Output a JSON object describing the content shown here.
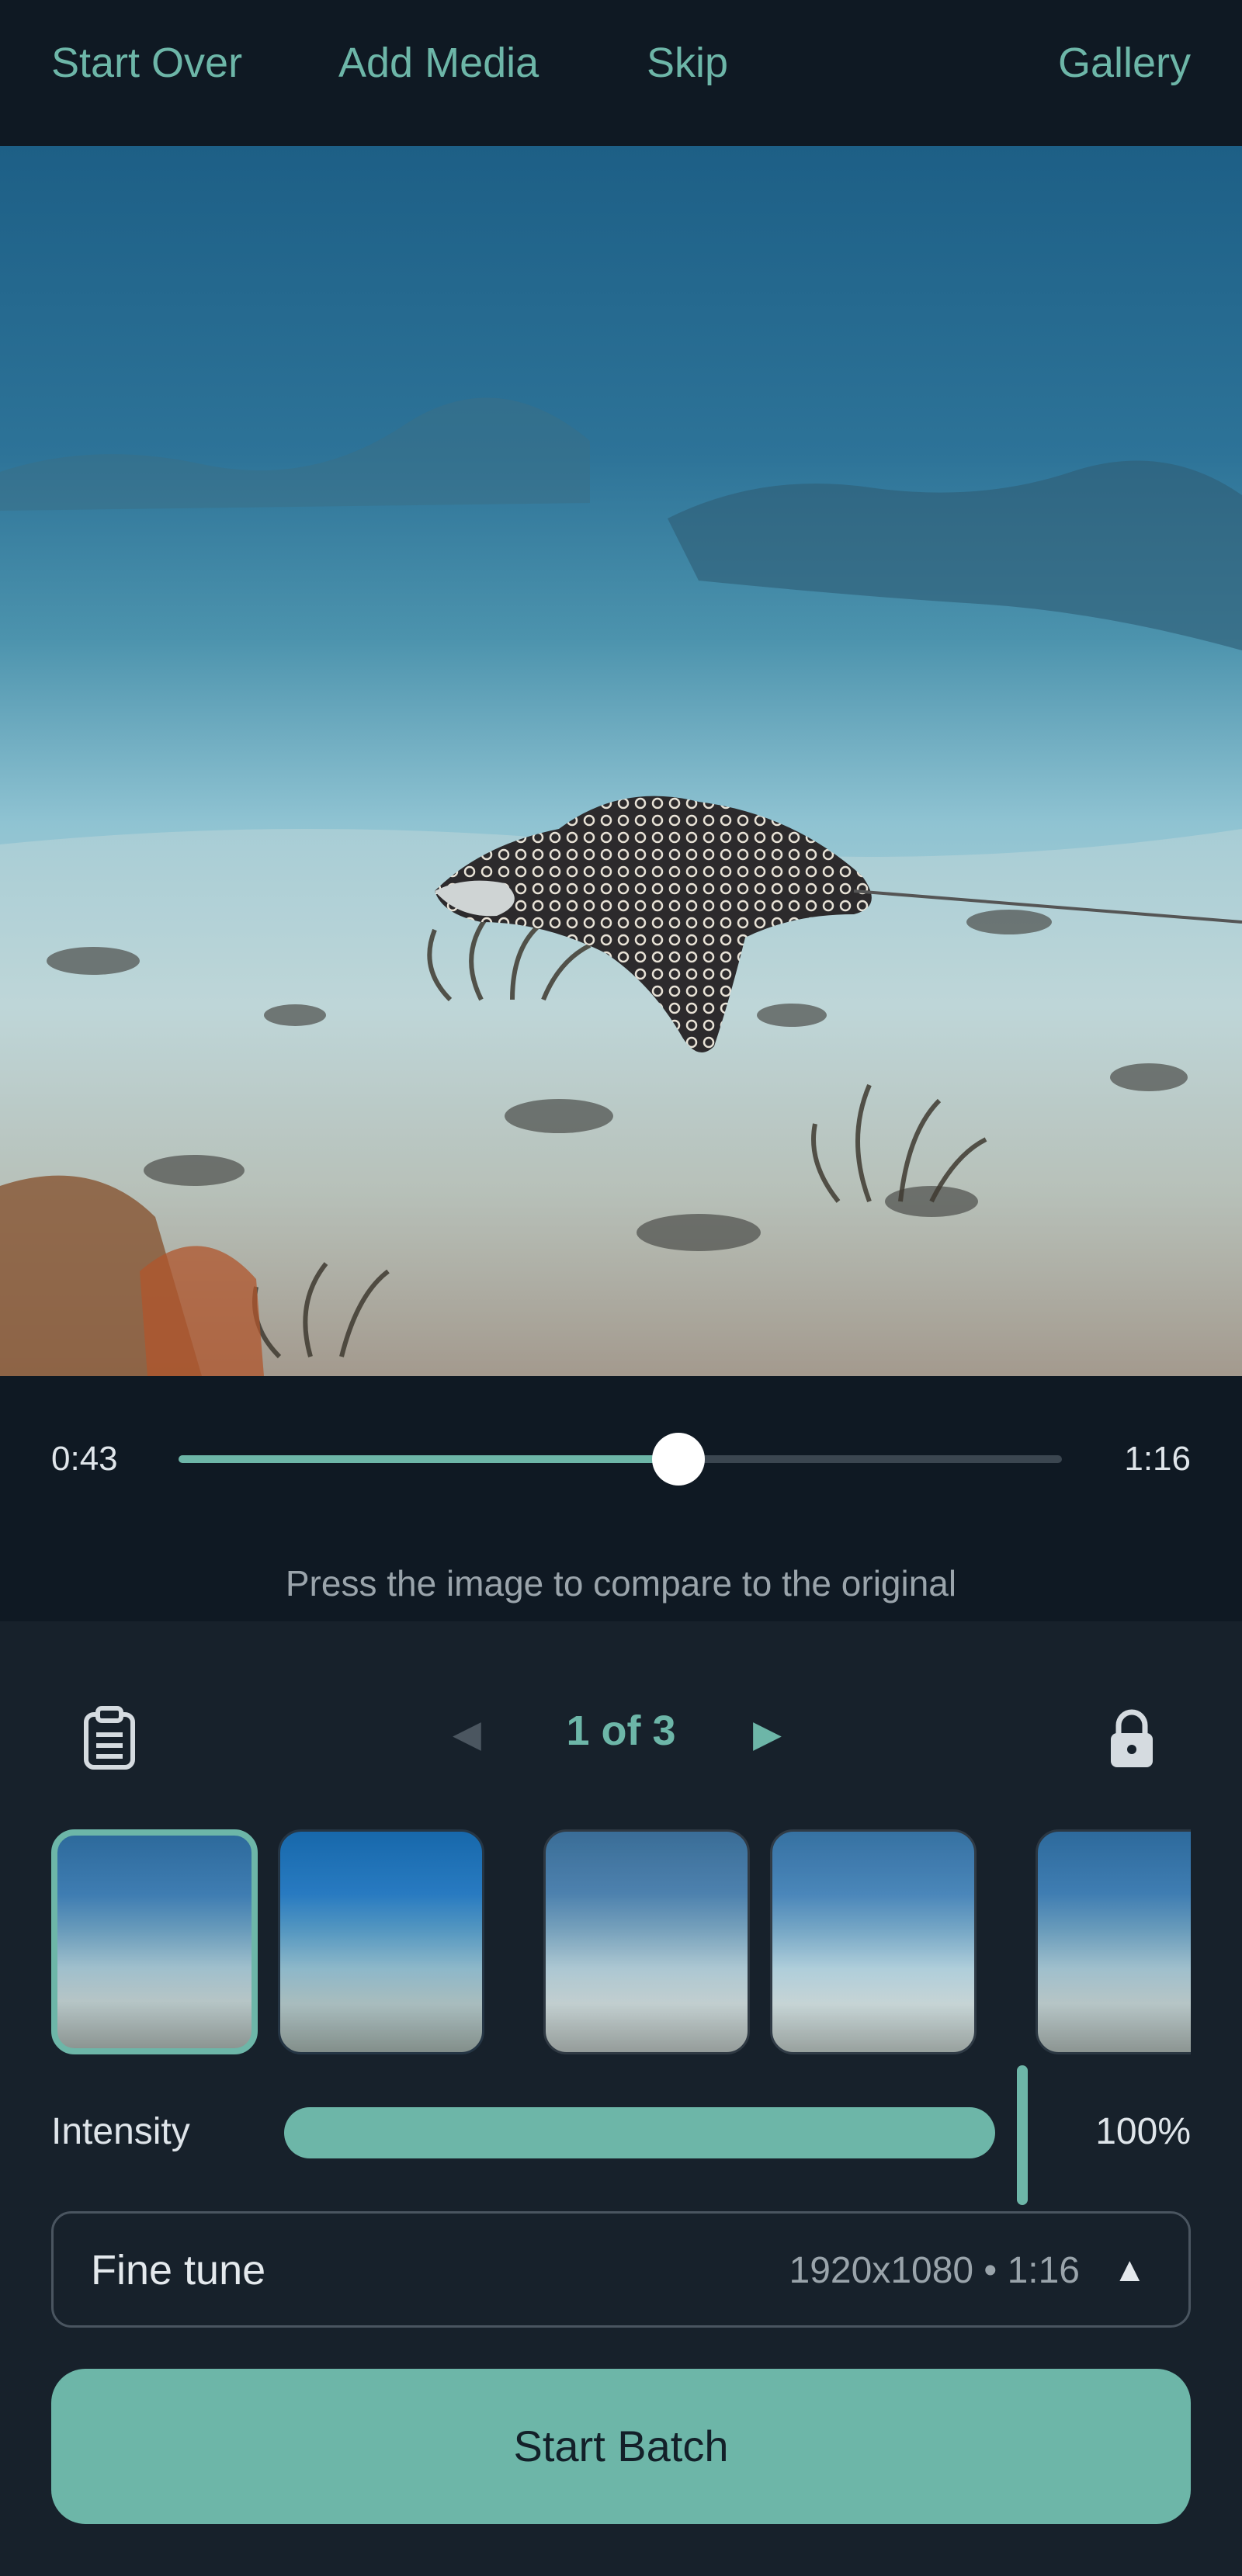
{
  "topbar": {
    "start_over": "Start Over",
    "add_media": "Add Media",
    "skip": "Skip",
    "gallery": "Gallery"
  },
  "playback": {
    "current_time": "0:43",
    "total_time": "1:16",
    "progress": 0.566,
    "hint": "Press the image to compare to the original"
  },
  "pager": {
    "label": "1 of 3",
    "prev_icon": "triangle-left-icon",
    "next_icon": "triangle-right-icon"
  },
  "icons": {
    "left": "clipboard-icon",
    "right": "lock-icon"
  },
  "filters": {
    "selected_index": 0,
    "count": 5
  },
  "intensity": {
    "label": "Intensity",
    "value_text": "100%",
    "value": 1.0
  },
  "fine_tune": {
    "label": "Fine tune",
    "meta": "1920x1080 • 1:16",
    "caret_icon": "caret-up-icon"
  },
  "start_batch": "Start Batch",
  "colors": {
    "accent": "#6db6a8",
    "background": "#17212b",
    "bar": "#0f1923"
  }
}
